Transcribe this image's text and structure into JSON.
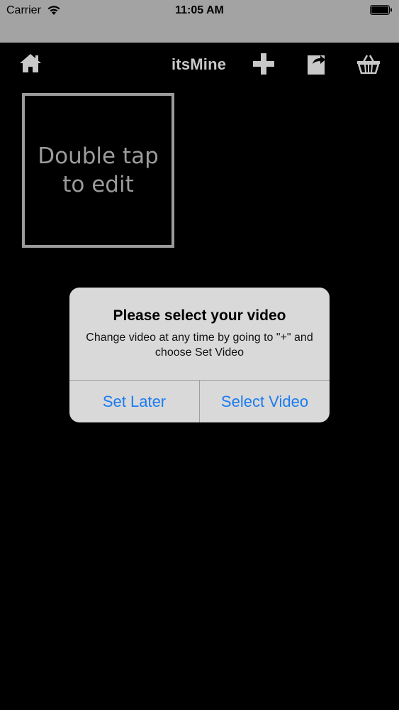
{
  "status_bar": {
    "carrier": "Carrier",
    "time": "11:05 AM"
  },
  "nav": {
    "title": "itsMine",
    "icons": [
      "home-icon",
      "plus-icon",
      "share-icon",
      "basket-icon"
    ]
  },
  "tile": {
    "text": "Double tap to edit"
  },
  "alert": {
    "title": "Please select your video",
    "message": "Change video at any time by going to \"+\" and choose Set Video",
    "buttons": {
      "left": "Set Later",
      "right": "Select Video"
    }
  },
  "colors": {
    "accent": "#1b7cf0",
    "status_bar_bg": "#a3a3a3",
    "tile_border": "#9b9b9b",
    "alert_bg": "#d9d9d9"
  }
}
